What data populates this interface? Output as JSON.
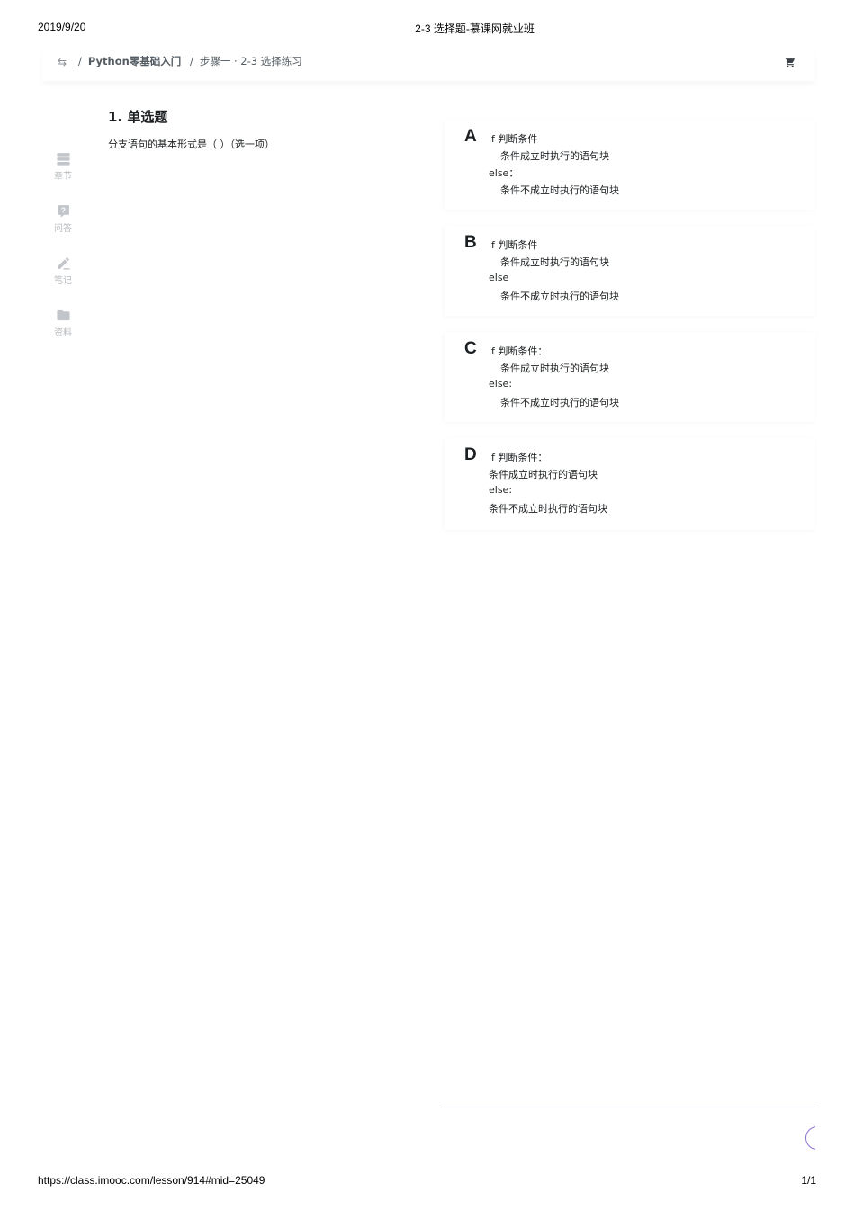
{
  "print_header": {
    "date": "2019/9/20",
    "title": "2-3 选择题-慕课网就业班"
  },
  "print_footer": {
    "url": "https://class.imooc.com/lesson/914#mid=25049",
    "page": "1/1"
  },
  "breadcrumb": {
    "separator": "/",
    "course": "Python零基础入门",
    "lesson": "步骤一 · 2-3 选择练习"
  },
  "sidebar": {
    "items": [
      {
        "label": "章节",
        "icon": "chapters-icon"
      },
      {
        "label": "问答",
        "icon": "question-icon"
      },
      {
        "label": "笔记",
        "icon": "pencil-icon"
      },
      {
        "label": "资料",
        "icon": "folder-icon"
      }
    ]
  },
  "question": {
    "title": "1. 单选题",
    "text": "分支语句的基本形式是（ ）（选一项）"
  },
  "options": [
    {
      "letter": "A",
      "lines": [
        "if 判断条件",
        "条件成立时执行的语句块",
        "else：",
        "条件不成立时执行的语句块"
      ]
    },
    {
      "letter": "B",
      "lines": [
        "if 判断条件",
        "条件成立时执行的语句块",
        "else",
        "条件不成立时执行的语句块"
      ]
    },
    {
      "letter": "C",
      "lines": [
        "if 判断条件：",
        "条件成立时执行的语句块",
        "else:",
        "条件不成立时执行的语句块"
      ]
    },
    {
      "letter": "D",
      "lines": [
        "if 判断条件：",
        "条件成立时执行的语句块",
        "else:",
        "条件不成立时执行的语句块"
      ]
    }
  ],
  "colors": {
    "text": "#1c1f21",
    "muted": "#b7bbbf",
    "accent": "#8c6fd6"
  }
}
